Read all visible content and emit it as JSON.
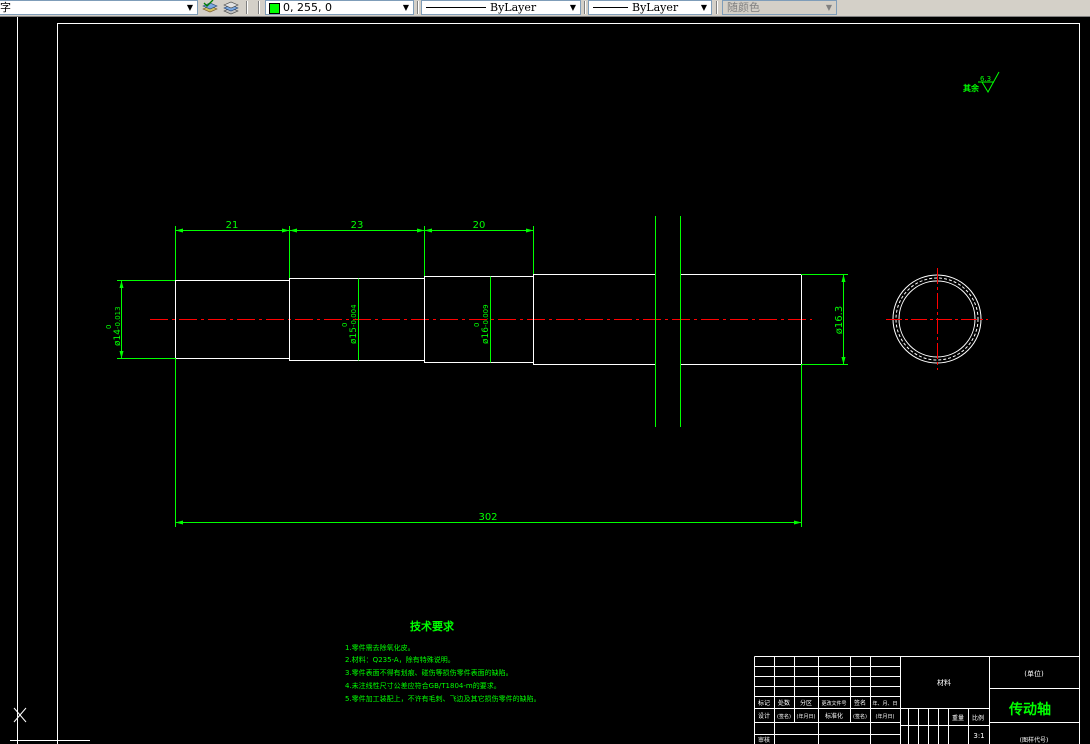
{
  "toolbar": {
    "style_combo_text": "字",
    "color_value": "0, 255, 0",
    "linetype_value": "ByLayer",
    "lineweight_value": "ByLayer",
    "plotstyle_value": "随颜色"
  },
  "drawing": {
    "dims": {
      "seg1": "21",
      "seg2": "23",
      "seg3": "20",
      "overall": "302",
      "dia1": "ø14",
      "dia1_tol": "-0.013",
      "dia1_up": "0",
      "dia2": "ø15",
      "dia2_tol": "-0.004",
      "dia2_up": "0",
      "dia3": "ø16",
      "dia3_tol": "-0.009",
      "dia3_up": "0",
      "dia4": "ø16.3"
    },
    "roughness": {
      "label": "其余",
      "value": "6.3"
    },
    "tech": {
      "heading": "技术要求",
      "lines": [
        "1.零件需去除氧化皮。",
        "2.材料：Q235-A，除有特殊说明。",
        "3.零件表面不得有划痕、碰伤等损伤零件表面的缺陷。",
        "4.未注线性尺寸公差应符合GB/T1804-m的要求。",
        "5.零件加工装配上，不许有毛刺、飞边及其它损伤零件的缺陷。"
      ]
    },
    "titleblock": {
      "material": "材料",
      "company": "(单位)",
      "part_name": "传动轴",
      "drawing_no": "(图样代号)",
      "mark": "标记",
      "count": "处数",
      "zone": "分区",
      "change_doc": "更改文件号",
      "sign": "签名",
      "date": "年、月、日",
      "designer": "设计",
      "signature": "(签名)",
      "ymd": "(年月日)",
      "std": "标准化",
      "weight": "重量",
      "scale": "比例",
      "scale_value": "3:1",
      "review": "审核"
    }
  }
}
